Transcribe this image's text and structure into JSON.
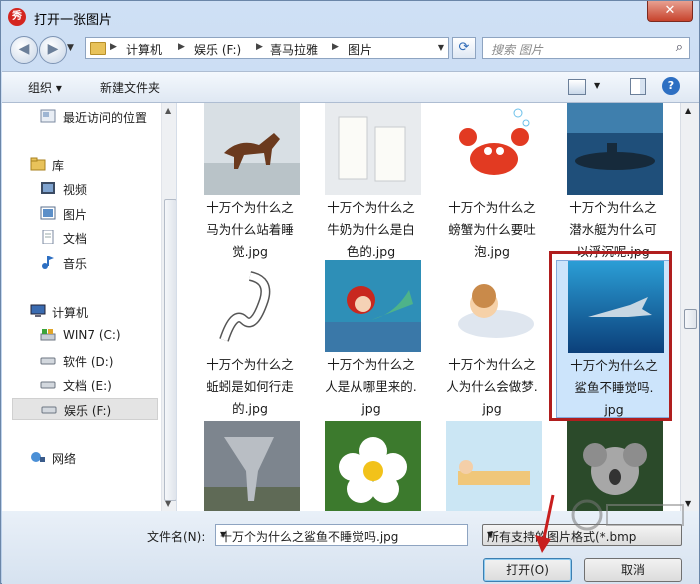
{
  "window": {
    "title": "打开一张图片",
    "app_icon_text": "秀",
    "close_label": "✕"
  },
  "nav": {
    "breadcrumbs": [
      "计算机",
      "娱乐 (F:)",
      "喜马拉雅",
      "图片"
    ],
    "search_placeholder": "搜索 图片"
  },
  "toolbar": {
    "organize": "组织 ▾",
    "new_folder": "新建文件夹",
    "help": "?"
  },
  "sidebar": {
    "items": [
      {
        "label": "最近访问的位置",
        "icon": "recent-places-icon"
      },
      {
        "label": "库",
        "icon": "library-icon"
      },
      {
        "label": "视频",
        "icon": "video-icon"
      },
      {
        "label": "图片",
        "icon": "pictures-icon"
      },
      {
        "label": "文档",
        "icon": "document-icon"
      },
      {
        "label": "音乐",
        "icon": "music-icon"
      },
      {
        "label": "计算机",
        "icon": "computer-icon"
      },
      {
        "label": "WIN7 (C:)",
        "icon": "system-drive-icon"
      },
      {
        "label": "软件 (D:)",
        "icon": "drive-icon"
      },
      {
        "label": "文档 (E:)",
        "icon": "drive-icon"
      },
      {
        "label": "娱乐 (F:)",
        "icon": "drive-icon"
      },
      {
        "label": "网络",
        "icon": "network-icon"
      }
    ]
  },
  "files": [
    {
      "line1": "十万个为什么之",
      "line2": "马为什么站着睡",
      "line3": "觉.jpg",
      "thumb": "horse"
    },
    {
      "line1": "十万个为什么之",
      "line2": "牛奶为什么是白",
      "line3": "色的.jpg",
      "thumb": "milk"
    },
    {
      "line1": "十万个为什么之",
      "line2": "螃蟹为什么要吐",
      "line3": "泡.jpg",
      "thumb": "crab"
    },
    {
      "line1": "十万个为什么之",
      "line2": "潜水艇为什么可",
      "line3": "以浮沉呢.jpg",
      "thumb": "submarine"
    },
    {
      "line1": "十万个为什么之",
      "line2": "蚯蚓是如何行走",
      "line3": "的.jpg",
      "thumb": "worm"
    },
    {
      "line1": "十万个为什么之",
      "line2": "人是从哪里来的.",
      "line3": "jpg",
      "thumb": "mermaid"
    },
    {
      "line1": "十万个为什么之",
      "line2": "人为什么会做梦.",
      "line3": "jpg",
      "thumb": "dream"
    },
    {
      "line1": "十万个为什么之",
      "line2": "鲨鱼不睡觉吗.",
      "line3": "jpg",
      "thumb": "shark"
    },
    {
      "line1": "",
      "line2": "",
      "line3": "",
      "thumb": "tornado"
    },
    {
      "line1": "",
      "line2": "",
      "line3": "",
      "thumb": "flower"
    },
    {
      "line1": "",
      "line2": "",
      "line3": "",
      "thumb": "sleep"
    },
    {
      "line1": "",
      "line2": "",
      "line3": "",
      "thumb": "koala"
    }
  ],
  "bottom": {
    "filename_label": "文件名(N):",
    "filename_value": "十万个为什么之鲨鱼不睡觉吗.jpg",
    "filetype_value": "所有支持的图片格式(*.bmp",
    "open_button": "打开(O)",
    "cancel_button": "取消"
  },
  "colors": {
    "accent": "#2d6fc2",
    "selection": "#cce4fb",
    "highlight_border": "#b01e1e"
  }
}
